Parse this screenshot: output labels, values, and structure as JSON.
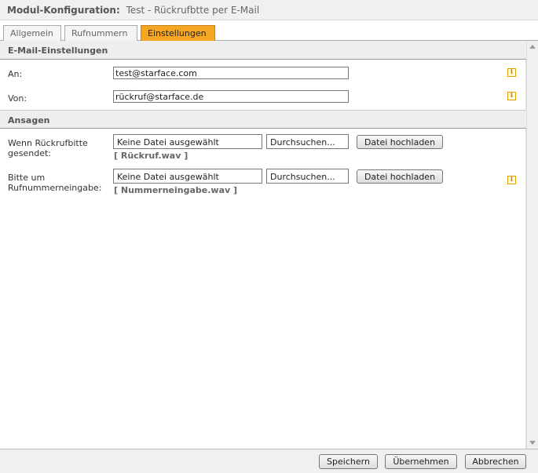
{
  "title": {
    "label": "Modul-Konfiguration:",
    "subtitle": "Test - Rückrufbtte per E-Mail"
  },
  "tabs": [
    {
      "label": "Allgemein",
      "active": false
    },
    {
      "label": "Rufnummern",
      "active": false
    },
    {
      "label": "Einstellungen",
      "active": true
    }
  ],
  "email_section": {
    "header": "E-Mail-Einstellungen",
    "to_label": "An:",
    "to_value": "test@starface.com",
    "from_label": "Von:",
    "from_value": "rückruf@starface.de"
  },
  "announcements": {
    "header": "Ansagen",
    "items": [
      {
        "label_line1": "Wenn Rückrufbitte",
        "label_line2": "gesendet:",
        "file_placeholder": "Keine Datei ausgewählt",
        "browse_label": "Durchsuchen...",
        "upload_label": "Datei hochladen",
        "current_file": "[ Rückruf.wav ]"
      },
      {
        "label_line1": "Bitte um",
        "label_line2": "Rufnummerneingabe:",
        "file_placeholder": "Keine Datei ausgewählt",
        "browse_label": "Durchsuchen...",
        "upload_label": "Datei hochladen",
        "current_file": "[ Nummerneingabe.wav ]"
      }
    ]
  },
  "footer": {
    "save_label": "Speichern",
    "apply_label": "Übernehmen",
    "cancel_label": "Abbrechen"
  },
  "colors": {
    "active_tab": "#f5a623",
    "info_icon": "#d08a00"
  },
  "icons": [
    "info-icon",
    "scroll-up-icon",
    "scroll-down-icon"
  ]
}
